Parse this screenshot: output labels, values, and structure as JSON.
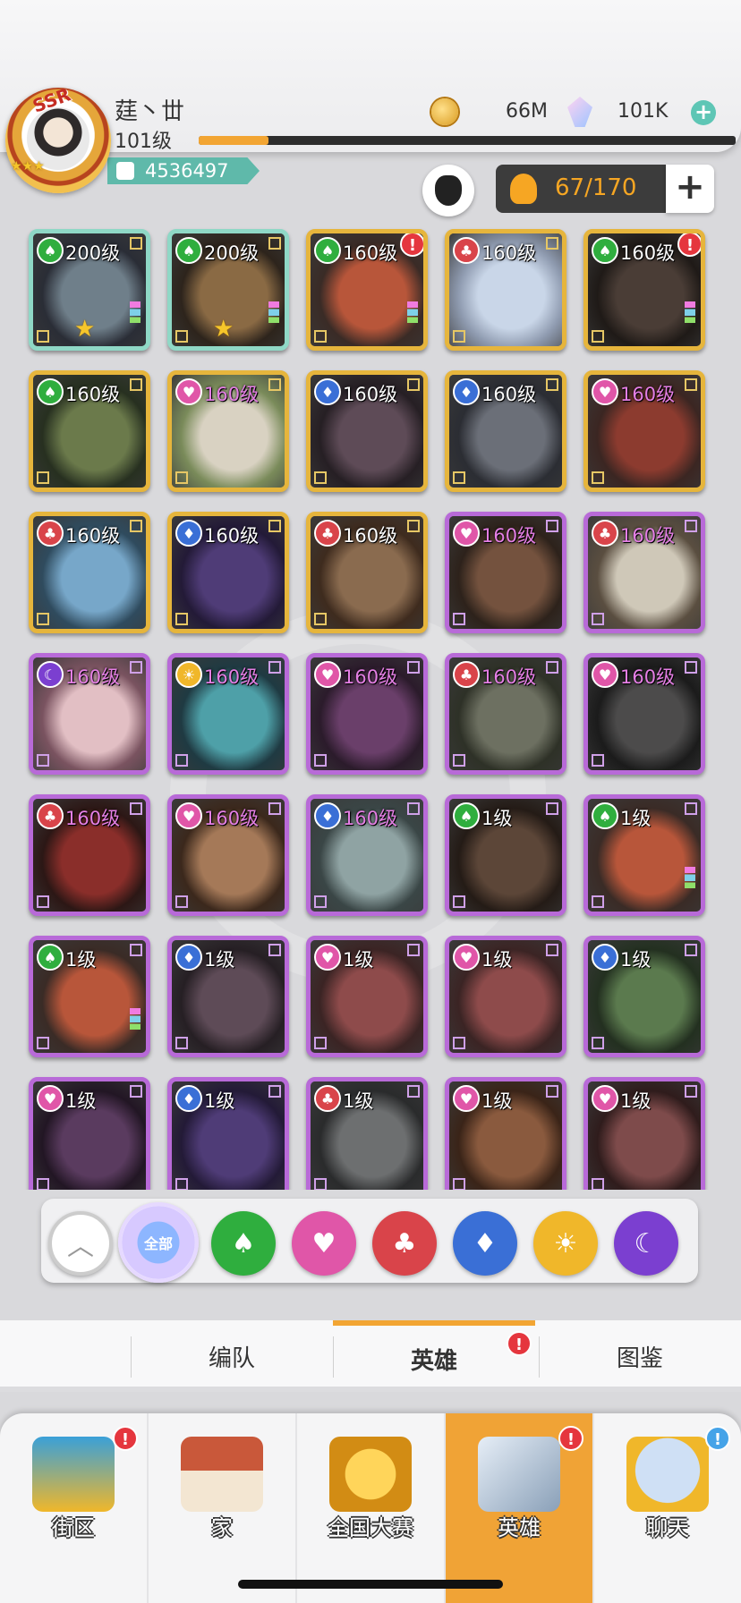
{
  "player": {
    "name": "莛丶丗",
    "level": "101级",
    "power": "4536497",
    "avatar_badge": "SSR",
    "xp_progress": 0.13
  },
  "currency": {
    "coins": "66M",
    "gems": "101K"
  },
  "roster": {
    "count": "67/170"
  },
  "colors": {
    "accent": "#f2a533",
    "teal": "#5fb9aa",
    "alert": "#e5363e"
  },
  "heroes": [
    {
      "level": "200级",
      "element": "green",
      "frame": "teal",
      "alert": false
    },
    {
      "level": "200级",
      "element": "green",
      "frame": "teal",
      "alert": false
    },
    {
      "level": "160级",
      "element": "green",
      "frame": "gold",
      "alert": true
    },
    {
      "level": "160级",
      "element": "red",
      "frame": "gold",
      "alert": false
    },
    {
      "level": "160级",
      "element": "green",
      "frame": "gold",
      "alert": true
    },
    {
      "level": "160级",
      "element": "green",
      "frame": "gold",
      "alert": false
    },
    {
      "level": "160级",
      "element": "pink",
      "frame": "gold",
      "alert": false
    },
    {
      "level": "160级",
      "element": "blue",
      "frame": "gold",
      "alert": false
    },
    {
      "level": "160级",
      "element": "blue",
      "frame": "gold",
      "alert": false
    },
    {
      "level": "160级",
      "element": "pink",
      "frame": "gold",
      "alert": false
    },
    {
      "level": "160级",
      "element": "red",
      "frame": "gold",
      "alert": false
    },
    {
      "level": "160级",
      "element": "blue",
      "frame": "gold",
      "alert": false
    },
    {
      "level": "160级",
      "element": "red",
      "frame": "gold",
      "alert": false
    },
    {
      "level": "160级",
      "element": "pink",
      "frame": "purple",
      "alert": false
    },
    {
      "level": "160级",
      "element": "red",
      "frame": "purple",
      "alert": false
    },
    {
      "level": "160级",
      "element": "purple",
      "frame": "purple",
      "alert": false
    },
    {
      "level": "160级",
      "element": "gold",
      "frame": "purple",
      "alert": false
    },
    {
      "level": "160级",
      "element": "pink",
      "frame": "purple",
      "alert": false
    },
    {
      "level": "160级",
      "element": "red",
      "frame": "purple",
      "alert": false
    },
    {
      "level": "160级",
      "element": "pink",
      "frame": "purple",
      "alert": false
    },
    {
      "level": "160级",
      "element": "red",
      "frame": "purple",
      "alert": false
    },
    {
      "level": "160级",
      "element": "pink",
      "frame": "purple",
      "alert": false
    },
    {
      "level": "160级",
      "element": "blue",
      "frame": "purple",
      "alert": false
    },
    {
      "level": "1级",
      "element": "green",
      "frame": "purple",
      "alert": false
    },
    {
      "level": "1级",
      "element": "green",
      "frame": "purple",
      "alert": false
    },
    {
      "level": "1级",
      "element": "green",
      "frame": "purple",
      "alert": false
    },
    {
      "level": "1级",
      "element": "blue",
      "frame": "purple",
      "alert": false
    },
    {
      "level": "1级",
      "element": "pink",
      "frame": "purple",
      "alert": false
    },
    {
      "level": "1级",
      "element": "pink",
      "frame": "purple",
      "alert": false
    },
    {
      "level": "1级",
      "element": "blue",
      "frame": "purple",
      "alert": false
    },
    {
      "level": "1级",
      "element": "pink",
      "frame": "purple",
      "alert": false
    },
    {
      "level": "1级",
      "element": "blue",
      "frame": "purple",
      "alert": false
    },
    {
      "level": "1级",
      "element": "red",
      "frame": "purple",
      "alert": false
    },
    {
      "level": "1级",
      "element": "pink",
      "frame": "purple",
      "alert": false
    },
    {
      "level": "1级",
      "element": "pink",
      "frame": "purple",
      "alert": false
    }
  ],
  "filters": {
    "all_label": "全部",
    "items": [
      "green",
      "pink",
      "red",
      "blue",
      "gold",
      "purple"
    ]
  },
  "subtabs": {
    "formation": "编队",
    "heroes": "英雄",
    "codex": "图鉴"
  },
  "nav": {
    "street": "街区",
    "home": "家",
    "national": "全国大赛",
    "heroes": "英雄",
    "chat": "聊天"
  },
  "alert_mark": "!"
}
